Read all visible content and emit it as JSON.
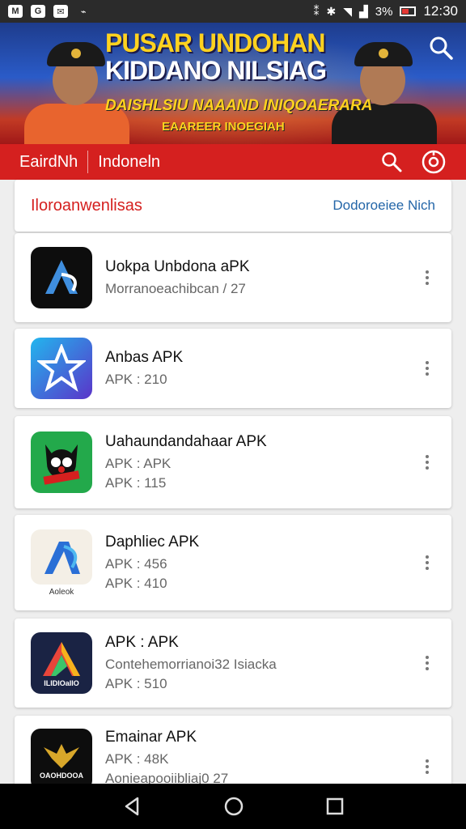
{
  "status_bar": {
    "time": "12:30",
    "battery": "3%",
    "left_icons": [
      "M",
      "G",
      "mail",
      "link"
    ]
  },
  "banner": {
    "title_line1": "PUSAR UNDOHAN",
    "title_line2": "KIDDANO NILSIAG",
    "subtitle": "DAISHLSIU NAAAND INIQOAERARA",
    "tagline": "EAAREER INOEGIAH"
  },
  "header_bar": {
    "tab1": "EairdNh",
    "tab2": "Indoneln"
  },
  "section": {
    "title": "Iloroanwenlisas",
    "link": "Dodoroeiee Nich"
  },
  "apps": [
    {
      "name": "Uokpa Unbdona aPK",
      "lines": [
        "Morranoeachibcan / 27"
      ],
      "icon": "blue-a-logo-dark",
      "colors": {
        "bg": "#0d0d0d",
        "fg": "#3f8ede"
      }
    },
    {
      "name": "Anbas APK",
      "lines": [
        "APK  :  210"
      ],
      "icon": "star-a-logo",
      "colors": {
        "bg": "#1f7ee0",
        "fg": "#ffffff"
      }
    },
    {
      "name": "Uahaundandahaar APK",
      "lines": [
        "APK  :  APK",
        "APK  :  115"
      ],
      "icon": "cartoon-cat-logo",
      "colors": {
        "bg": "#23a94b",
        "fg": "#d5201f"
      }
    },
    {
      "name": "Daphliec APK",
      "lines": [
        "APK  :  456",
        "APK  :  410"
      ],
      "icon": "gradient-a-logo",
      "colors": {
        "bg": "#f4efe6",
        "fg": "#2a6fd6"
      },
      "caption": "Aoleok"
    },
    {
      "name": "APK  :  APK",
      "lines": [
        "Contehemorrianoi32  Isiacka",
        "APK  :  510"
      ],
      "icon": "colorful-a-logo",
      "colors": {
        "bg": "#1a2344",
        "fg": "#e9453a"
      },
      "caption": "ILIDIOaIIO"
    },
    {
      "name": "Emainar APK",
      "lines": [
        "APK  :  48K",
        "Aonieapooiibliaj0 27"
      ],
      "icon": "garuda-logo",
      "colors": {
        "bg": "#0d0d0d",
        "fg": "#d8a72a"
      },
      "caption": "OAOHDOOA"
    }
  ]
}
